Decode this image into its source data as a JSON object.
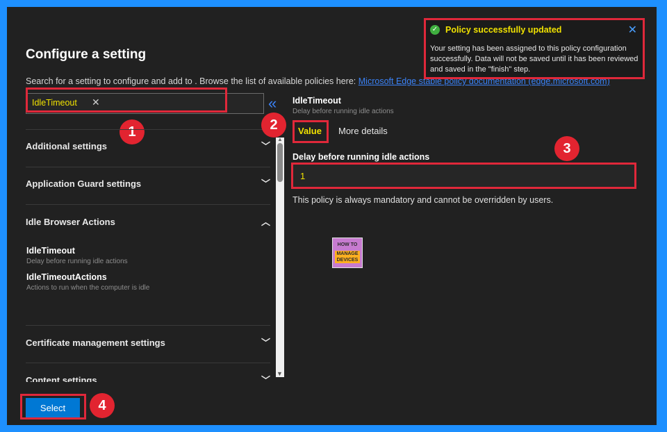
{
  "page": {
    "title": "Configure a setting",
    "description": "Search for a setting to configure and add to . Browse the list of available policies here:",
    "link_text": "Microsoft Edge stable policy documentation (edge.microsoft.com)"
  },
  "search": {
    "value": "IdleTimeout",
    "clear_glyph": "✕"
  },
  "collapse_glyph": "«",
  "groups": [
    {
      "label": "Additional settings",
      "chevron": "﹀"
    },
    {
      "label": "Application Guard settings",
      "chevron": "﹀"
    },
    {
      "label": "Idle Browser Actions",
      "chevron": "︿"
    },
    {
      "label": "Certificate management settings",
      "chevron": "﹀"
    },
    {
      "label": "Content settings",
      "chevron": "﹀"
    }
  ],
  "idle_items": [
    {
      "title": "IdleTimeout",
      "subtitle": "Delay before running idle actions"
    },
    {
      "title": "IdleTimeoutActions",
      "subtitle": "Actions to run when the computer is idle"
    }
  ],
  "detail": {
    "title": "IdleTimeout",
    "subtitle": "Delay before running idle actions",
    "tabs": [
      "Value",
      "More details"
    ],
    "field_label": "Delay before running idle actions",
    "field_value": "1",
    "note": "This policy is always mandatory and cannot be overridden by users."
  },
  "logo": {
    "line1": "HOW TO",
    "line2": "MANAGE DEVICES"
  },
  "select_label": "Select",
  "toast": {
    "title": "Policy successfully updated",
    "body": "Your setting has been assigned to this policy configuration successfully. Data will not be saved until it has been reviewed and saved in the \"finish\" step.",
    "close_glyph": "✕",
    "check_glyph": "✓"
  },
  "badges": [
    "1",
    "2",
    "3",
    "4"
  ],
  "colors": {
    "accent": "#0078d4",
    "highlight": "#f1e200",
    "annotation": "#e0283a",
    "success": "#3fae3f"
  },
  "icons": [
    "check-circle-icon",
    "close-icon",
    "double-chevron-left-icon",
    "chevron-down-icon",
    "chevron-up-icon"
  ]
}
